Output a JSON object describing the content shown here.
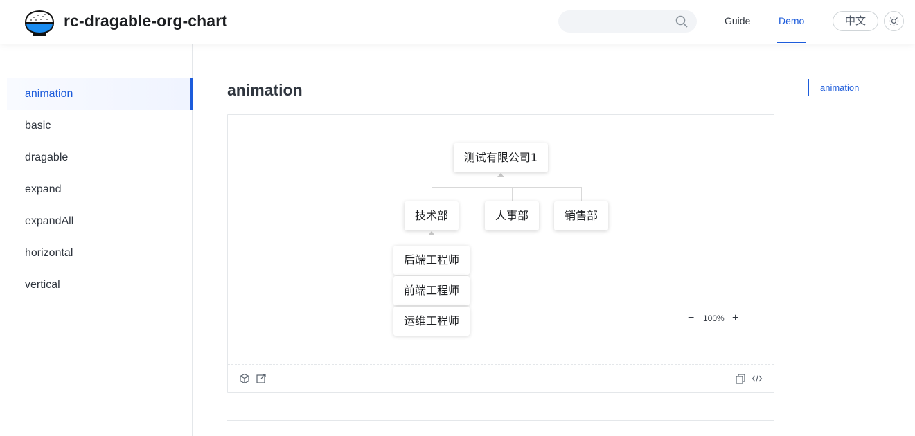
{
  "header": {
    "site_title": "rc-dragable-org-chart",
    "search_placeholder": "",
    "nav": [
      {
        "label": "Guide",
        "active": false
      },
      {
        "label": "Demo",
        "active": true
      }
    ],
    "lang_label": "中文",
    "accent_color": "#1d5cdb"
  },
  "sidebar": {
    "items": [
      {
        "label": "animation",
        "active": true
      },
      {
        "label": "basic",
        "active": false
      },
      {
        "label": "dragable",
        "active": false
      },
      {
        "label": "expand",
        "active": false
      },
      {
        "label": "expandAll",
        "active": false
      },
      {
        "label": "horizontal",
        "active": false
      },
      {
        "label": "vertical",
        "active": false
      }
    ]
  },
  "main": {
    "title": "animation",
    "demo": {
      "org_chart": {
        "root": "测试有限公司1",
        "departments": [
          "技术部",
          "人事部",
          "销售部"
        ],
        "tech_children": [
          "后端工程师",
          "前端工程师",
          "运维工程师"
        ]
      },
      "zoom": {
        "minus": "−",
        "value": "100%",
        "plus": "+"
      },
      "actions": {
        "left": [
          "codesandbox-icon",
          "open-external-icon"
        ],
        "right": [
          "copy-icon",
          "code-icon"
        ]
      }
    }
  },
  "toc": {
    "items": [
      "animation"
    ]
  }
}
